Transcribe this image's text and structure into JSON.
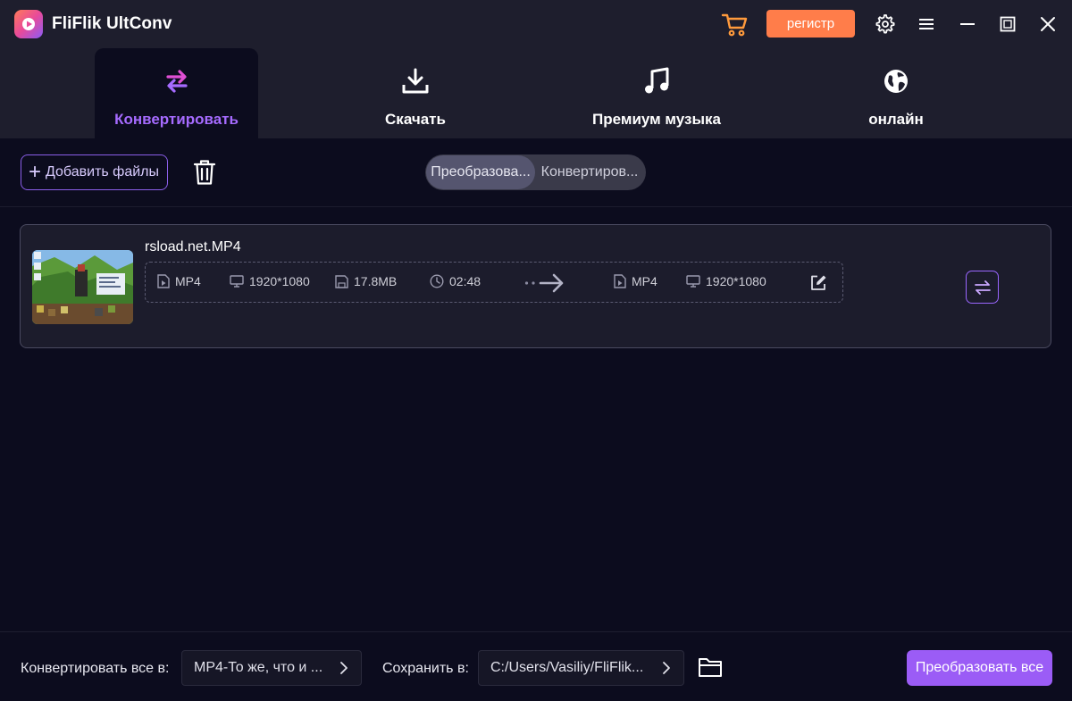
{
  "app": {
    "title": "FliFlik UltConv"
  },
  "titlebar": {
    "register_label": "регистр",
    "register_color": "#ff7d4a",
    "icons": [
      "cart-icon",
      "gear-icon",
      "menu-icon",
      "minimize-icon",
      "maximize-icon",
      "close-icon"
    ]
  },
  "nav": {
    "tabs": [
      {
        "label": "Конвертировать",
        "icon": "convert-icon",
        "active": true
      },
      {
        "label": "Скачать",
        "icon": "download-icon",
        "active": false
      },
      {
        "label": "Премиум музыка",
        "icon": "music-note-icon",
        "active": false
      },
      {
        "label": "онлайн",
        "icon": "globe-icon",
        "active": false
      }
    ],
    "active_color": "#a66bff"
  },
  "toolbar": {
    "add_files_label": "Добавить файлы",
    "mode_options": [
      {
        "label": "Преобразова...",
        "selected": true
      },
      {
        "label": "Конвертиров...",
        "selected": false
      }
    ]
  },
  "file": {
    "name": "rsload.net.MP4",
    "source": {
      "format": "MP4",
      "resolution": "1920*1080",
      "size": "17.8MB",
      "duration": "02:48"
    },
    "target": {
      "format": "MP4",
      "resolution": "1920*1080"
    }
  },
  "bottom": {
    "convert_all_to_label": "Конвертировать все в:",
    "format_value": "MP4-То же, что и ...",
    "save_to_label": "Сохранить в:",
    "path_value": "C:/Users/Vasiliy/FliFlik...",
    "convert_all_button": "Преобразовать все",
    "accent_color": "#9b5cf6"
  }
}
